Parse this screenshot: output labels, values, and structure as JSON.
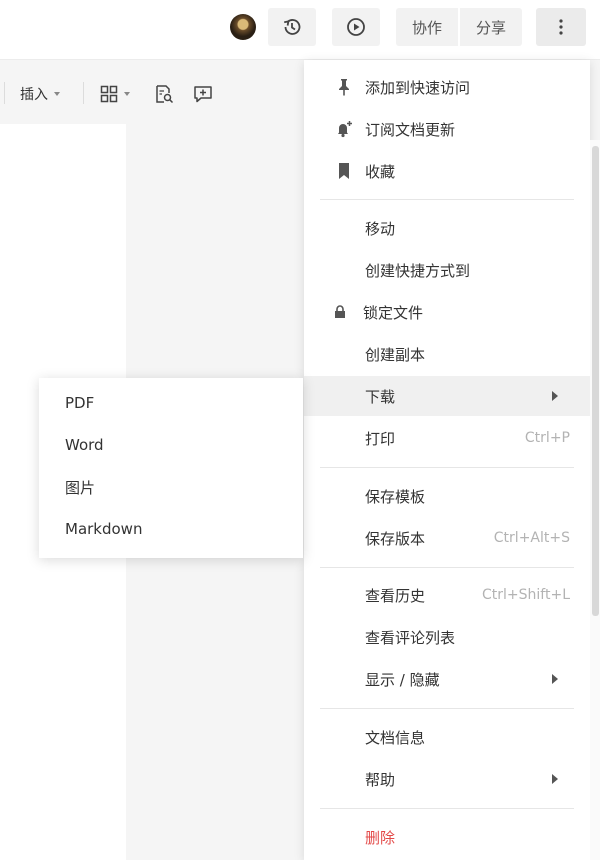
{
  "topbar": {
    "collab_label": "协作",
    "share_label": "分享"
  },
  "toolbar": {
    "insert_label": "插入"
  },
  "menu": {
    "items": [
      {
        "label": "添加到快速访问",
        "icon": "pin-icon"
      },
      {
        "label": "订阅文档更新",
        "icon": "bell-plus-icon"
      },
      {
        "label": "收藏",
        "icon": "bookmark-icon"
      },
      {
        "label": "移动"
      },
      {
        "label": "创建快捷方式到"
      },
      {
        "label": "锁定文件",
        "icon": "lock-icon"
      },
      {
        "label": "创建副本"
      },
      {
        "label": "下载",
        "submenu": true,
        "active": true
      },
      {
        "label": "打印",
        "shortcut": "Ctrl+P"
      },
      {
        "label": "保存模板"
      },
      {
        "label": "保存版本",
        "shortcut": "Ctrl+Alt+S"
      },
      {
        "label": "查看历史",
        "shortcut": "Ctrl+Shift+L"
      },
      {
        "label": "查看评论列表"
      },
      {
        "label": "显示 / 隐藏",
        "submenu": true
      },
      {
        "label": "文档信息"
      },
      {
        "label": "帮助",
        "submenu": true
      },
      {
        "label": "删除",
        "danger": true
      }
    ]
  },
  "download_submenu": {
    "items": [
      "PDF",
      "Word",
      "图片",
      "Markdown"
    ]
  },
  "colors": {
    "danger": "#e34948",
    "shortcut": "#b3b3b3",
    "active_bg": "#f0f0f0"
  }
}
